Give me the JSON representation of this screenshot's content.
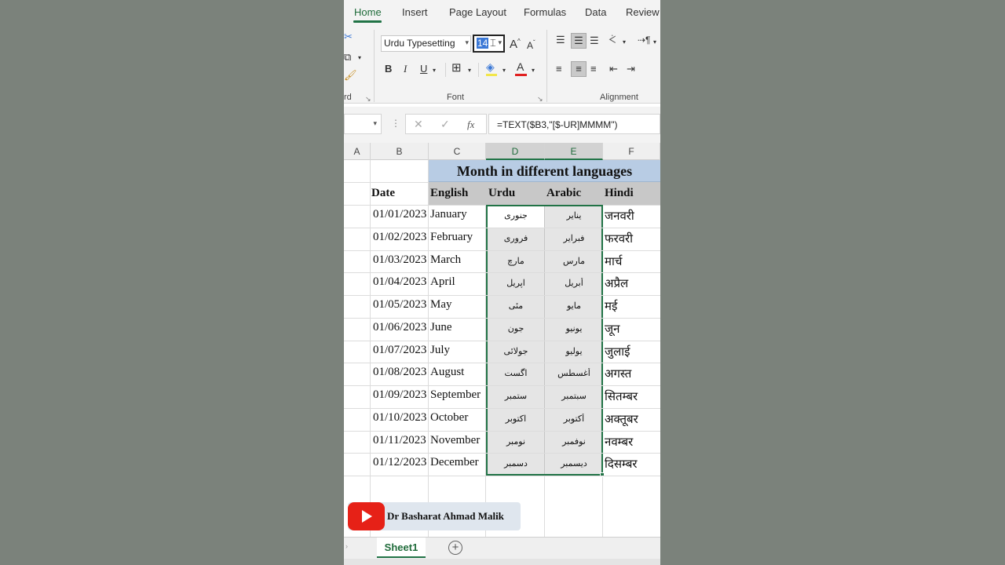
{
  "ribbon_tabs": [
    "Home",
    "Insert",
    "Page Layout",
    "Formulas",
    "Data",
    "Review"
  ],
  "ribbon": {
    "font_name": "Urdu Typesetting",
    "font_size": "14",
    "font_group_label": "Font",
    "alignment_group_label": "Alignment",
    "clipboard_group_label_partial": "rd",
    "bold": "B",
    "italic": "I",
    "underline": "U",
    "increase_font": "A",
    "decrease_font": "A",
    "font_color": "A"
  },
  "formula_bar": {
    "fx": "fx",
    "formula": "=TEXT($B3,\"[$-UR]MMMM\")"
  },
  "columns": [
    {
      "label": "A",
      "selected": false
    },
    {
      "label": "B",
      "selected": false
    },
    {
      "label": "C",
      "selected": false
    },
    {
      "label": "D",
      "selected": true
    },
    {
      "label": "E",
      "selected": true
    },
    {
      "label": "F",
      "selected": false
    }
  ],
  "sheet": {
    "title": "Month in different languages",
    "headers": {
      "date": "Date",
      "english": "English",
      "urdu": "Urdu",
      "arabic": "Arabic",
      "hindi": "Hindi"
    },
    "rows": [
      {
        "date": "01/01/2023",
        "english": "January",
        "urdu": "جنوری",
        "arabic": "يناير",
        "hindi": "जनवरी"
      },
      {
        "date": "01/02/2023",
        "english": "February",
        "urdu": "فروری",
        "arabic": "فبراير",
        "hindi": "फरवरी"
      },
      {
        "date": "01/03/2023",
        "english": "March",
        "urdu": "مارچ",
        "arabic": "مارس",
        "hindi": "मार्च"
      },
      {
        "date": "01/04/2023",
        "english": "April",
        "urdu": "اپریل",
        "arabic": "أبريل",
        "hindi": "अप्रैल"
      },
      {
        "date": "01/05/2023",
        "english": "May",
        "urdu": "مئی",
        "arabic": "مايو",
        "hindi": "मई"
      },
      {
        "date": "01/06/2023",
        "english": "June",
        "urdu": "جون",
        "arabic": "يونيو",
        "hindi": "जून"
      },
      {
        "date": "01/07/2023",
        "english": "July",
        "urdu": "جولائی",
        "arabic": "يوليو",
        "hindi": "जुलाई"
      },
      {
        "date": "01/08/2023",
        "english": "August",
        "urdu": "اگست",
        "arabic": "أغسطس",
        "hindi": "अगस्त"
      },
      {
        "date": "01/09/2023",
        "english": "September",
        "urdu": "ستمبر",
        "arabic": "سبتمبر",
        "hindi": "सितम्बर"
      },
      {
        "date": "01/10/2023",
        "english": "October",
        "urdu": "اکتوبر",
        "arabic": "أكتوبر",
        "hindi": "अक्तूबर"
      },
      {
        "date": "01/11/2023",
        "english": "November",
        "urdu": "نومبر",
        "arabic": "نوفمبر",
        "hindi": "नवम्बर"
      },
      {
        "date": "01/12/2023",
        "english": "December",
        "urdu": "دسمبر",
        "arabic": "ديسمبر",
        "hindi": "दिसम्बर"
      }
    ]
  },
  "channel_badge": "Dr Basharat Ahmad  Malik",
  "sheet_tabs": [
    "Sheet1"
  ],
  "colors": {
    "accent": "#217346",
    "title_fill": "#b8cce4",
    "header_fill": "#c8c8c8",
    "font_color_bar": "#e02020",
    "youtube_red": "#e62117"
  }
}
